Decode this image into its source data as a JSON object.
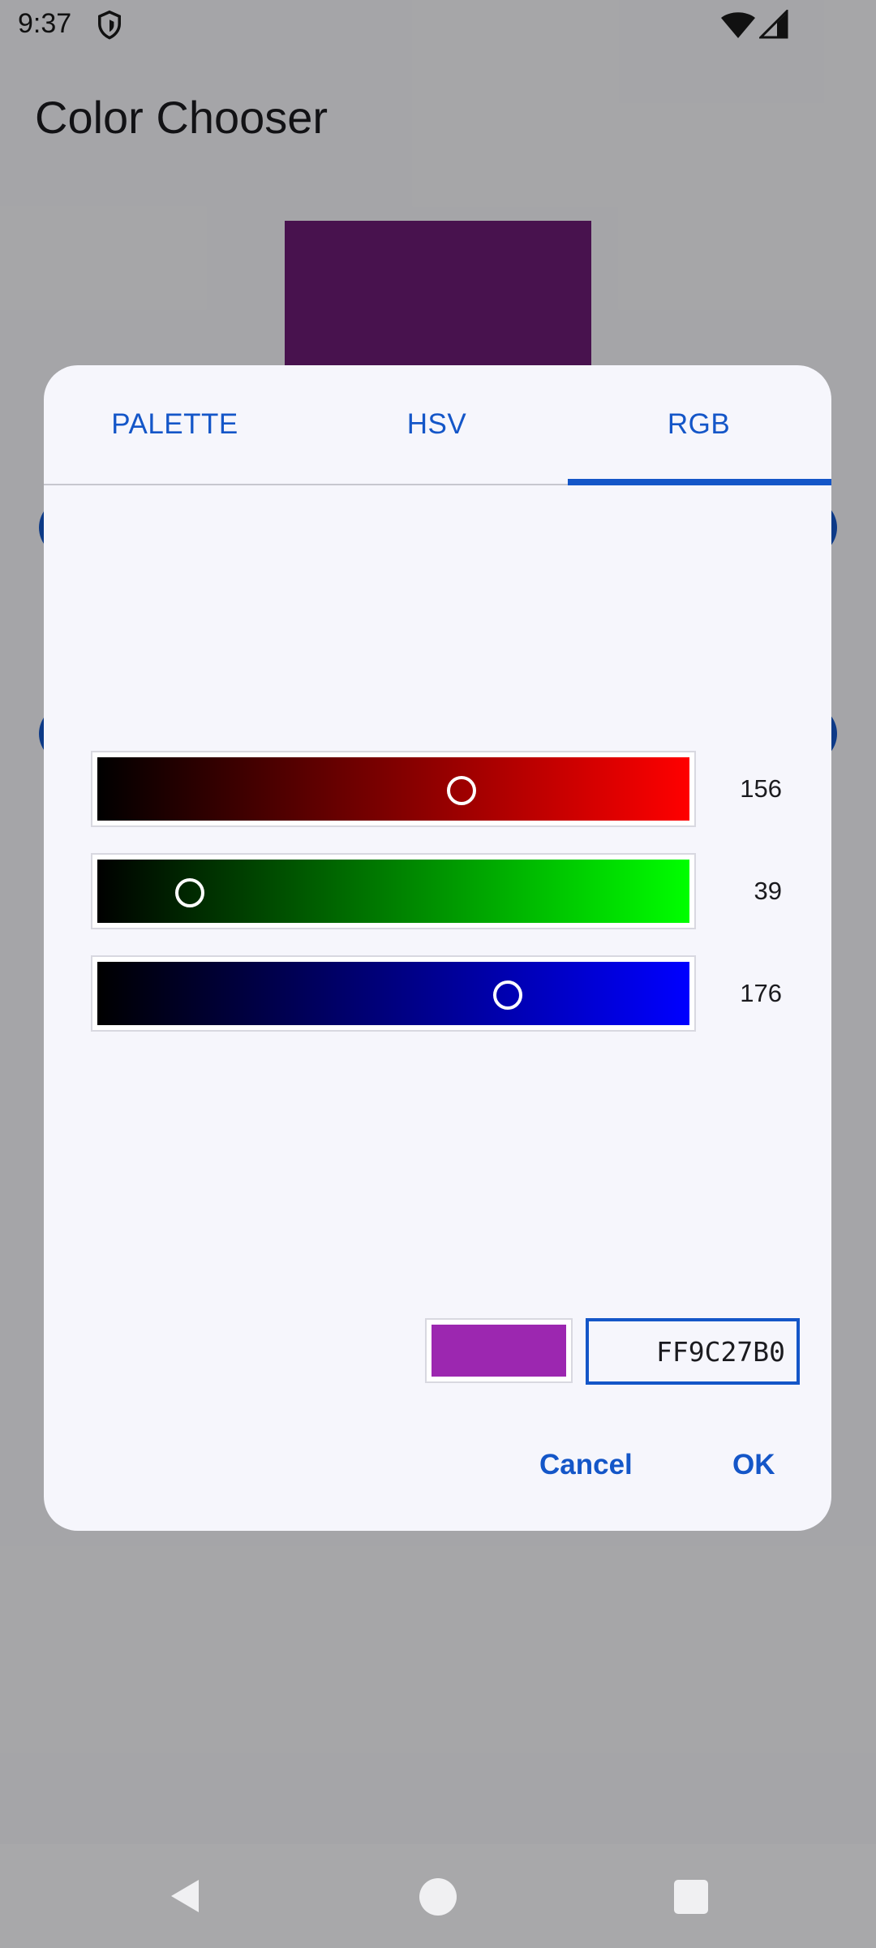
{
  "status_bar": {
    "time": "9:37"
  },
  "app": {
    "title": "Color Chooser",
    "preview_color": "#6a1b74",
    "button_color": "#1456c8"
  },
  "dialog": {
    "tabs": [
      {
        "label": "PALETTE",
        "selected": false
      },
      {
        "label": "HSV",
        "selected": false
      },
      {
        "label": "RGB",
        "selected": true
      }
    ],
    "sliders": [
      {
        "channel": "red",
        "value": "156",
        "fraction": 0.612
      },
      {
        "channel": "green",
        "value": "39",
        "fraction": 0.153
      },
      {
        "channel": "blue",
        "value": "176",
        "fraction": 0.69
      }
    ],
    "swatch_color": "#9c27b0",
    "hex_value": "FF9C27B0",
    "cancel_label": "Cancel",
    "ok_label": "OK"
  },
  "nav_bar": {
    "icons": [
      "back-icon",
      "home-icon",
      "recents-icon"
    ]
  }
}
